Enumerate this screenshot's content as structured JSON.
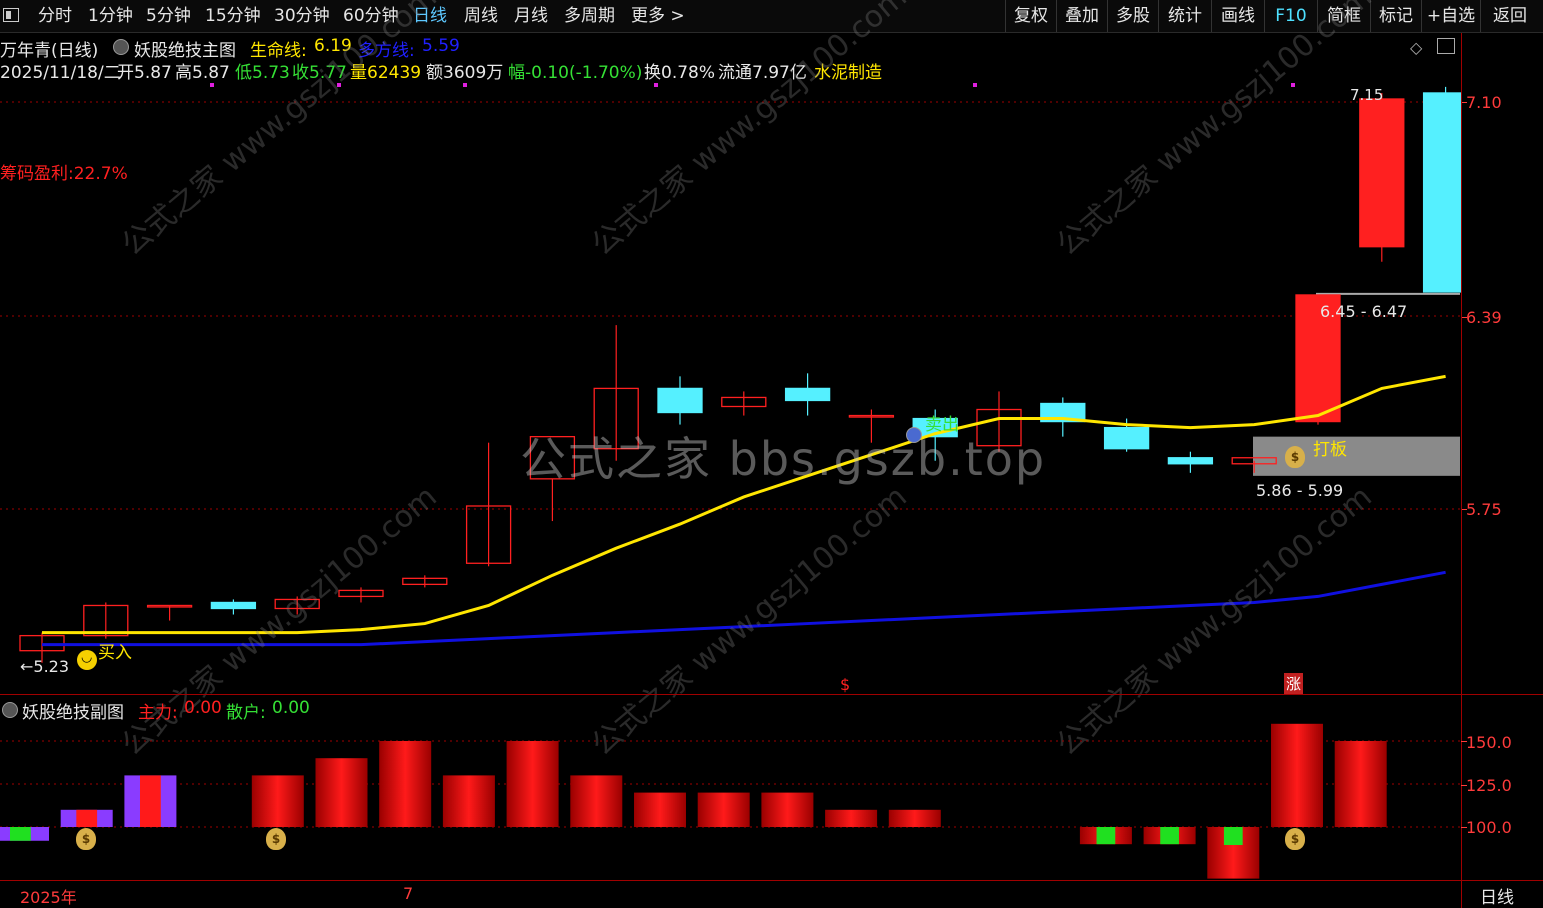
{
  "toolbar": {
    "left_items": [
      "分时",
      "1分钟",
      "5分钟",
      "15分钟",
      "30分钟",
      "60分钟",
      "日线",
      "周线",
      "月线",
      "多周期",
      "更多 >"
    ],
    "active": "日线",
    "right_items": [
      "复权",
      "叠加",
      "多股",
      "统计",
      "画线",
      "F10",
      "简框",
      "标记",
      "+自选",
      "返回"
    ]
  },
  "header": {
    "stock": "万年青(日线)",
    "indicator": "妖股绝技主图",
    "life_line_label": "生命线:",
    "life_line_value": "6.19",
    "multi_line_label": "多方线:",
    "multi_line_value": "5.59",
    "date": "2025/11/18/二",
    "open": "开5.87",
    "high": "高5.87",
    "low": "低5.73",
    "close": "收5.77",
    "volume": "量62439",
    "amount": "额3609万",
    "change": "幅-0.10(-1.70%)",
    "turnover": "换0.78%",
    "float": "流通7.97亿",
    "sector": "水泥制造"
  },
  "main": {
    "chip_profit": "筹码盈利:22.7%",
    "price_axis": [
      "7.10",
      "6.39",
      "5.75"
    ],
    "low_marker": "←5.23",
    "buy_label": "买入",
    "sell_label": "卖出",
    "daban_label": "打板",
    "zone_upper_label": "6.45 - 6.47",
    "zone_lower_label": "5.86 - 5.99",
    "top_price_label": "7.15",
    "dollar_marker": "$",
    "zhang_marker": "涨",
    "watermark_center": "公式之家 bbs.gszb.top",
    "watermark_diag": "公式之家 www.gszj100.com"
  },
  "sub": {
    "title": "妖股绝技副图",
    "main_force_label": "主力:",
    "main_force_value": "0.00",
    "retail_label": "散户:",
    "retail_value": "0.00",
    "axis": [
      "150.0",
      "125.0",
      "100.0"
    ]
  },
  "bottom": {
    "year": "2025年",
    "month": "7",
    "period": "日线"
  },
  "colors": {
    "up": "#ff2020",
    "down": "#55f0ff",
    "life_line": "#ffe600",
    "multi_line": "#1010e0",
    "grid": "#a00000",
    "sub_purple": "#8a3cff",
    "sub_green": "#20e020"
  },
  "chart_data": {
    "type": "candlestick",
    "price_axis_ticks": [
      7.1,
      6.39,
      5.75
    ],
    "candles": [
      {
        "o": 5.28,
        "h": 5.34,
        "l": 5.24,
        "c": 5.33
      },
      {
        "o": 5.33,
        "h": 5.44,
        "l": 5.32,
        "c": 5.43
      },
      {
        "o": 5.43,
        "h": 5.43,
        "l": 5.38,
        "c": 5.43
      },
      {
        "o": 5.44,
        "h": 5.45,
        "l": 5.4,
        "c": 5.42
      },
      {
        "o": 5.42,
        "h": 5.46,
        "l": 5.4,
        "c": 5.45
      },
      {
        "o": 5.46,
        "h": 5.49,
        "l": 5.44,
        "c": 5.48
      },
      {
        "o": 5.5,
        "h": 5.53,
        "l": 5.49,
        "c": 5.52
      },
      {
        "o": 5.57,
        "h": 5.97,
        "l": 5.56,
        "c": 5.76
      },
      {
        "o": 5.85,
        "h": 5.85,
        "l": 5.71,
        "c": 5.99
      },
      {
        "o": 5.95,
        "h": 6.36,
        "l": 5.91,
        "c": 6.15
      },
      {
        "o": 6.15,
        "h": 6.19,
        "l": 6.03,
        "c": 6.07
      },
      {
        "o": 6.09,
        "h": 6.14,
        "l": 6.06,
        "c": 6.12
      },
      {
        "o": 6.15,
        "h": 6.2,
        "l": 6.06,
        "c": 6.11
      },
      {
        "o": 6.06,
        "h": 6.08,
        "l": 5.97,
        "c": 6.06
      },
      {
        "o": 6.05,
        "h": 6.08,
        "l": 5.91,
        "c": 5.99
      },
      {
        "o": 5.96,
        "h": 6.14,
        "l": 5.94,
        "c": 6.08
      },
      {
        "o": 6.1,
        "h": 6.12,
        "l": 5.99,
        "c": 6.04
      },
      {
        "o": 6.02,
        "h": 6.05,
        "l": 5.94,
        "c": 5.95
      },
      {
        "o": 5.92,
        "h": 5.94,
        "l": 5.87,
        "c": 5.9
      },
      {
        "o": 5.9,
        "h": 5.91,
        "l": 5.87,
        "c": 5.92
      },
      {
        "o": 6.04,
        "h": 6.46,
        "l": 6.03,
        "c": 6.46
      },
      {
        "o": 6.62,
        "h": 7.13,
        "l": 6.57,
        "c": 7.11
      },
      {
        "o": 7.13,
        "h": 7.15,
        "l": 6.47,
        "c": 6.47
      }
    ],
    "life_line": [
      5.34,
      5.34,
      5.34,
      5.34,
      5.34,
      5.35,
      5.37,
      5.43,
      5.53,
      5.62,
      5.7,
      5.79,
      5.86,
      5.93,
      6.0,
      6.05,
      6.05,
      6.03,
      6.02,
      6.03,
      6.06,
      6.15,
      6.19
    ],
    "multi_line": [
      5.3,
      5.3,
      5.3,
      5.3,
      5.3,
      5.3,
      5.31,
      5.32,
      5.33,
      5.34,
      5.35,
      5.36,
      5.37,
      5.38,
      5.39,
      5.4,
      5.41,
      5.42,
      5.43,
      5.44,
      5.46,
      5.5,
      5.54
    ],
    "sub_bars": [
      {
        "v": 92,
        "c": "mix-gp"
      },
      {
        "v": 110,
        "c": "mix-pr"
      },
      {
        "v": 130,
        "c": "mix-pr"
      },
      {
        "v": 0,
        "c": "none"
      },
      {
        "v": 130,
        "c": "red"
      },
      {
        "v": 140,
        "c": "red"
      },
      {
        "v": 150,
        "c": "red"
      },
      {
        "v": 130,
        "c": "red"
      },
      {
        "v": 150,
        "c": "red"
      },
      {
        "v": 130,
        "c": "red"
      },
      {
        "v": 120,
        "c": "red"
      },
      {
        "v": 120,
        "c": "red"
      },
      {
        "v": 120,
        "c": "red"
      },
      {
        "v": 110,
        "c": "red"
      },
      {
        "v": 110,
        "c": "red"
      },
      {
        "v": 0,
        "c": "none"
      },
      {
        "v": 0,
        "c": "none"
      },
      {
        "v": 90,
        "c": "mix-gr"
      },
      {
        "v": 90,
        "c": "mix-gr"
      },
      {
        "v": 70,
        "c": "mix-gr"
      },
      {
        "v": 160,
        "c": "red"
      },
      {
        "v": 150,
        "c": "red"
      }
    ],
    "sub_axis": [
      150.0,
      125.0,
      100.0
    ]
  }
}
